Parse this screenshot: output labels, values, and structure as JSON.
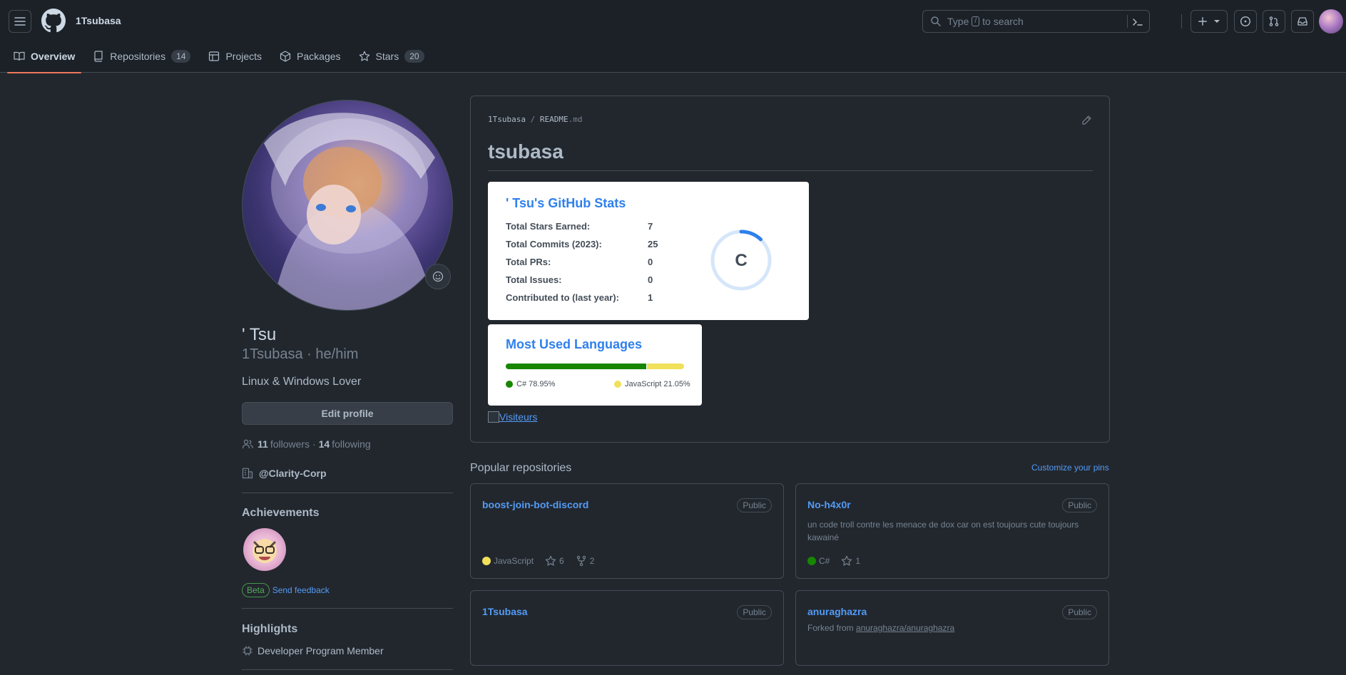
{
  "header": {
    "owner": "1Tsubasa",
    "search_before": "Type",
    "search_key": "/",
    "search_after": "to search"
  },
  "tabs": [
    {
      "label": "Overview"
    },
    {
      "label": "Repositories",
      "count": "14"
    },
    {
      "label": "Projects"
    },
    {
      "label": "Packages"
    },
    {
      "label": "Stars",
      "count": "20"
    }
  ],
  "profile": {
    "name": "' Tsu",
    "login": "1Tsubasa · he/him",
    "bio": "Linux & Windows Lover",
    "edit_label": "Edit profile",
    "followers_count": "11",
    "followers_label": "followers ·",
    "following_count": "14",
    "following_label": "following",
    "org": "@Clarity-Corp",
    "achievements_title": "Achievements",
    "beta_label": "Beta",
    "feedback_label": "Send feedback",
    "highlights_title": "Highlights",
    "highlight_item": "Developer Program Member"
  },
  "readme": {
    "path_owner": "1Tsubasa",
    "path_sep": " / ",
    "path_file": "README",
    "path_ext": ".md",
    "title": "tsubasa",
    "stats": {
      "title": "' Tsu's GitHub Stats",
      "rows": [
        {
          "label": "Total Stars Earned:",
          "value": "7"
        },
        {
          "label": "Total Commits (2023):",
          "value": "25"
        },
        {
          "label": "Total PRs:",
          "value": "0"
        },
        {
          "label": "Total Issues:",
          "value": "0"
        },
        {
          "label": "Contributed to (last year):",
          "value": "1"
        }
      ],
      "rank": "C",
      "rank_progress": 0.12
    },
    "languages": {
      "title": "Most Used Languages",
      "items": [
        {
          "name": "C#",
          "percent": 78.95,
          "label": "C# 78.95%",
          "color": "#178600"
        },
        {
          "name": "JavaScript",
          "percent": 21.05,
          "label": "JavaScript 21.05%",
          "color": "#f1e05a"
        }
      ]
    },
    "visitors_alt": "Visiteurs"
  },
  "popular": {
    "title": "Popular repositories",
    "customize": "Customize your pins",
    "repos": [
      {
        "name": "boost-join-bot-discord",
        "visibility": "Public",
        "language": "JavaScript",
        "lang_color": "#f1e05a",
        "stars": "6",
        "forks": "2"
      },
      {
        "name": "No-h4x0r",
        "visibility": "Public",
        "description": "un code troll contre les menace de dox car on est toujours cute toujours kawainé",
        "language": "C#",
        "lang_color": "#178600",
        "stars": "1"
      },
      {
        "name": "1Tsubasa",
        "visibility": "Public"
      },
      {
        "name": "anuraghazra",
        "visibility": "Public",
        "forked_prefix": "Forked from",
        "forked_from": "anuraghazra/anuraghazra"
      }
    ]
  }
}
